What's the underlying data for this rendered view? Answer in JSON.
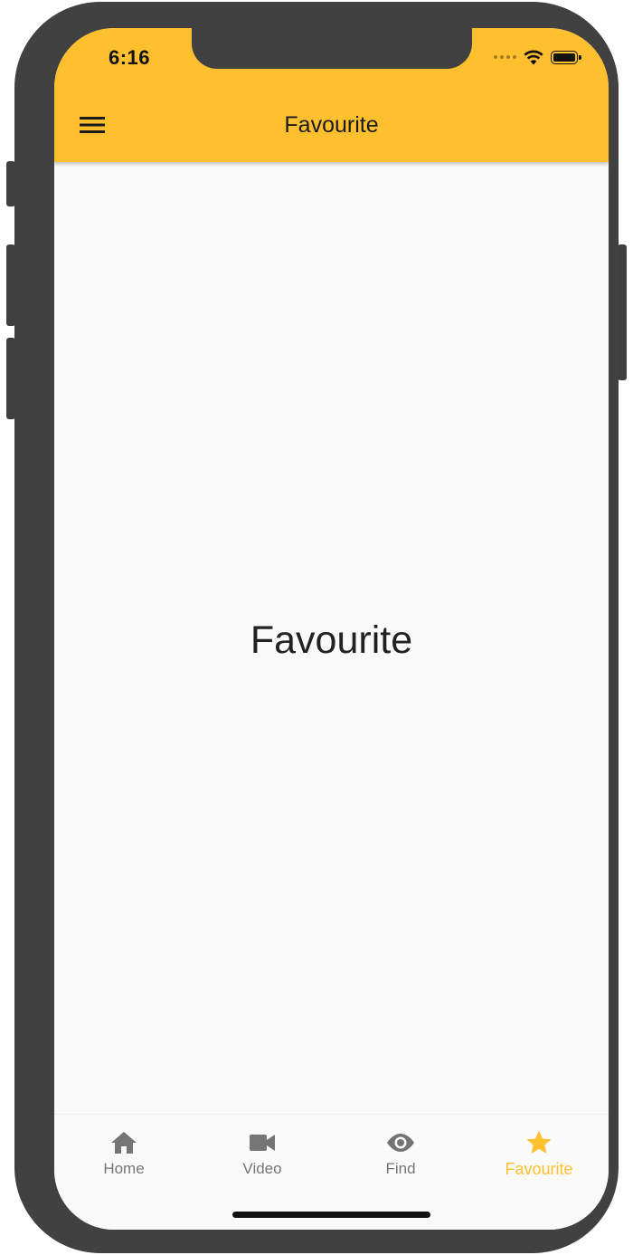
{
  "status_bar": {
    "time": "6:16"
  },
  "app_bar": {
    "title": "Favourite",
    "background_color": "#fec02e",
    "menu_icon": "hamburger-menu-icon"
  },
  "main": {
    "center_text": "Favourite"
  },
  "bottom_nav": {
    "active_color": "#fec02e",
    "inactive_color": "#757575",
    "items": [
      {
        "label": "Home",
        "icon": "home-icon",
        "active": false
      },
      {
        "label": "Video",
        "icon": "video-camera-icon",
        "active": false
      },
      {
        "label": "Find",
        "icon": "eye-icon",
        "active": false
      },
      {
        "label": "Favourite",
        "icon": "star-icon",
        "active": true
      }
    ]
  }
}
